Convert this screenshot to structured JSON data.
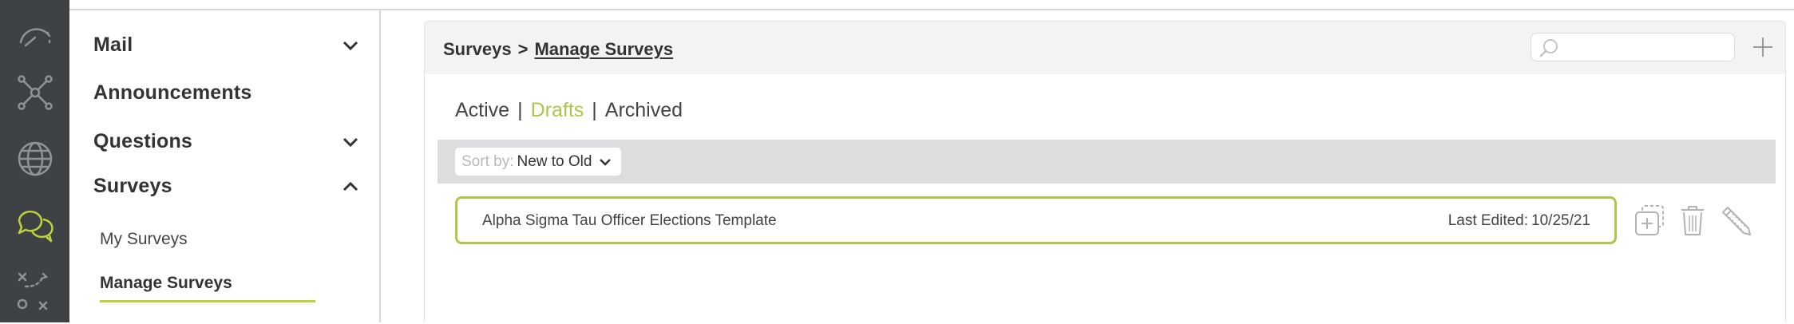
{
  "rail": {
    "icons": [
      "dashboard-gauge-icon",
      "network-nodes-icon",
      "globe-icon",
      "chat-bubbles-icon",
      "strategy-play-icon"
    ],
    "active_index": 3,
    "active_color": "#c0d23b",
    "icon_color": "#8f9296"
  },
  "sidebar": {
    "mail": "Mail",
    "announcements": "Announcements",
    "questions": "Questions",
    "surveys": "Surveys",
    "my_surveys": "My Surveys",
    "manage_surveys": "Manage Surveys"
  },
  "breadcrumb": {
    "parent": "Surveys",
    "separator": ">",
    "current": "Manage Surveys"
  },
  "search": {
    "placeholder": "",
    "value": ""
  },
  "tabs": {
    "active": "Active",
    "drafts": "Drafts",
    "archived": "Archived",
    "separator": "|",
    "selected": "Drafts"
  },
  "sort": {
    "prefix": "Sort by:",
    "value": "New to Old"
  },
  "surveys": [
    {
      "name": "Alpha Sigma Tau Officer Elections Template",
      "edited_label": "Last Edited:",
      "edited_date": "10/25/21"
    }
  ],
  "colors": {
    "accent": "#aec64a",
    "rail_bg": "#3f4245",
    "sort_bar": "#dbdddf"
  }
}
